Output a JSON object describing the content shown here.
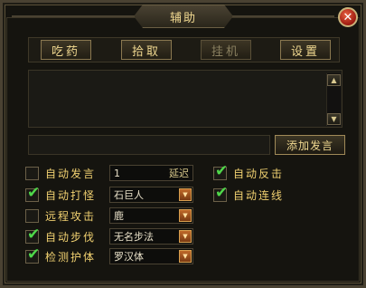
{
  "window": {
    "title": "辅助",
    "close_glyph": "✕"
  },
  "tabs": [
    {
      "label": "吃药",
      "enabled": true
    },
    {
      "label": "拾取",
      "enabled": true
    },
    {
      "label": "挂机",
      "enabled": false
    },
    {
      "label": "设置",
      "enabled": true
    }
  ],
  "chat": {
    "input_value": "",
    "add_button": "添加发言"
  },
  "scroll": {
    "up": "▲",
    "down": "▼"
  },
  "options": [
    {
      "label": "自动发言",
      "checked": false,
      "value": "1",
      "suffix": "延迟"
    },
    {
      "label": "自动打怪",
      "checked": true,
      "value": "石巨人"
    },
    {
      "label": "远程攻击",
      "checked": false,
      "value": "鹿"
    },
    {
      "label": "自动步伐",
      "checked": true,
      "value": "无名步法"
    },
    {
      "label": "检测护体",
      "checked": true,
      "value": "罗汉体"
    }
  ],
  "right_options": [
    {
      "label": "自动反击",
      "checked": true
    },
    {
      "label": "自动连线",
      "checked": true
    }
  ],
  "glyphs": {
    "check": "✔",
    "dropdown": "▼"
  },
  "colors": {
    "accent_gold": "#f0d070",
    "check_green": "#4fd84a",
    "close_red": "#c02a18"
  }
}
